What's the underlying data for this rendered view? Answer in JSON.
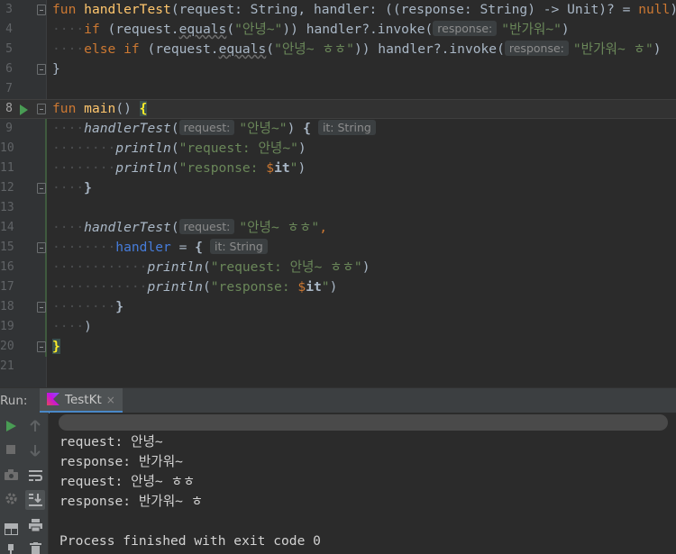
{
  "editor": {
    "lines": [
      {
        "num": "3"
      },
      {
        "num": "4"
      },
      {
        "num": "5"
      },
      {
        "num": "6"
      },
      {
        "num": "7"
      },
      {
        "num": "8"
      },
      {
        "num": "9"
      },
      {
        "num": "10"
      },
      {
        "num": "11"
      },
      {
        "num": "12"
      },
      {
        "num": "13"
      },
      {
        "num": "14"
      },
      {
        "num": "15"
      },
      {
        "num": "16"
      },
      {
        "num": "17"
      },
      {
        "num": "18"
      },
      {
        "num": "19"
      },
      {
        "num": "20"
      },
      {
        "num": "21"
      }
    ],
    "code": {
      "l3": {
        "kw_fun": "fun",
        "fn": "handlerTest",
        "rest": "(request: String, handler: ((response: String) -> Unit)? = ",
        "kw_null": "null",
        "tail": ") {"
      },
      "l4": {
        "kw_if": "if",
        "a": " (request.",
        "b": "equals",
        "c": "(",
        "str": "\"안녕~\"",
        "d": ")) handler?.invoke(",
        "hint": "response:",
        "str2": "\"반가워~\"",
        "e": ")"
      },
      "l5": {
        "kw_else": "else",
        "kw_if": "if",
        "a": " (request.",
        "b": "equals",
        "c": "(",
        "str": "\"안녕~ ㅎㅎ\"",
        "d": ")) handler?.invoke(",
        "hint": "response:",
        "str2": "\"반가워~ ㅎ\"",
        "e": ")"
      },
      "l6": {
        "t": "}"
      },
      "l8": {
        "kw_fun": "fun",
        "fn": "main",
        "a": "() ",
        "brace": "{"
      },
      "l9": {
        "fn": "handlerTest",
        "a": "(",
        "hint": "request:",
        "str": "\"안녕~\"",
        "b": ") ",
        "brace": "{",
        "ret_hint": "it: String"
      },
      "l10": {
        "fn": "println",
        "a": "(",
        "str": "\"request: 안녕~\"",
        "b": ")"
      },
      "l11": {
        "fn": "println",
        "a": "(",
        "str_a": "\"response: ",
        "tmpl": "$",
        "it": "it",
        "str_b": "\"",
        "b": ")"
      },
      "l12": {
        "t": "}"
      },
      "l14": {
        "fn": "handlerTest",
        "a": "(",
        "hint": "request:",
        "str": "\"안녕~ ㅎㅎ\"",
        "b": ","
      },
      "l15": {
        "par": "handler",
        "a": " = ",
        "brace": "{",
        "ret_hint": "it: String"
      },
      "l16": {
        "fn": "println",
        "a": "(",
        "str": "\"request: 안녕~ ㅎㅎ\"",
        "b": ")"
      },
      "l17": {
        "fn": "println",
        "a": "(",
        "str_a": "\"response: ",
        "tmpl": "$",
        "it": "it",
        "str_b": "\"",
        "b": ")"
      },
      "l18": {
        "t": "}"
      },
      "l19": {
        "t": ")"
      },
      "l20": {
        "brace": "}"
      }
    },
    "colors": {
      "background": "#2b2b2b",
      "keyword": "#cc7832",
      "function": "#ffc66d",
      "string": "#6a8759",
      "text": "#a9b7c6",
      "param": "#467cda"
    }
  },
  "run_panel": {
    "label": "Run:",
    "tab_label": "TestKt",
    "tab_close": "×",
    "toolbar_left": [
      "run-icon",
      "stop-icon",
      "camera-icon",
      "settings-icon",
      "layout-icon",
      "pin-icon"
    ],
    "toolbar_right": [
      "up-arrow-icon",
      "down-arrow-icon",
      "soft-wrap-icon",
      "scroll-to-end-icon",
      "print-icon",
      "trash-icon"
    ],
    "output": [
      "request: 안녕~",
      "response: 반가워~",
      "request: 안녕~ ㅎㅎ",
      "response: 반가워~ ㅎ",
      "",
      "Process finished with exit code 0"
    ]
  }
}
